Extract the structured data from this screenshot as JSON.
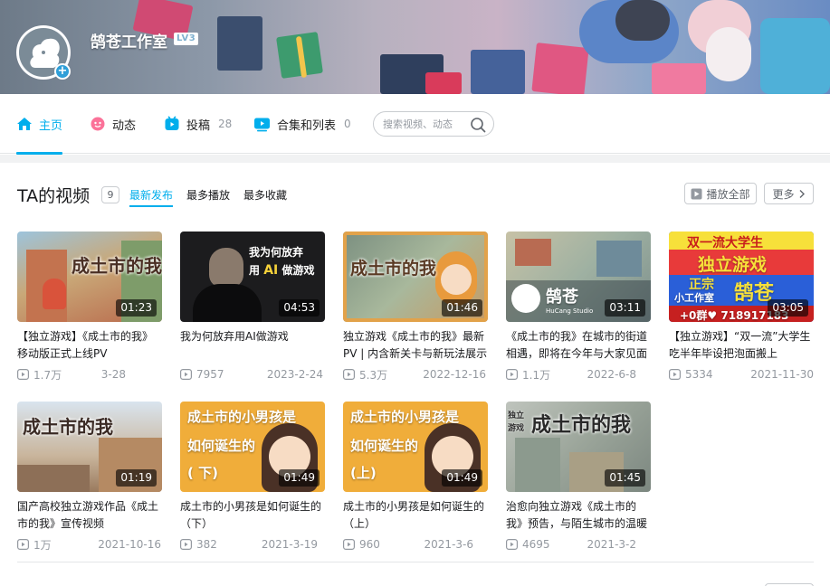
{
  "profile": {
    "name": "鹄苍工作室",
    "level": "LV3"
  },
  "nav": {
    "home": "主页",
    "dynamic": "动态",
    "videos": "投稿",
    "videos_count": "28",
    "collections": "合集和列表",
    "collections_count": "0"
  },
  "search": {
    "placeholder": "搜索视频、动态"
  },
  "section": {
    "title": "TA的视频",
    "count": "9",
    "sort_tabs": [
      "最新发布",
      "最多播放",
      "最多收藏"
    ],
    "play_all": "播放全部",
    "more": "更多"
  },
  "videos": [
    {
      "title": "【独立游戏】《成土市的我》移动版正式上线PV",
      "plays": "1.7万",
      "date": "3-28",
      "duration": "01:23",
      "thumb_text": "成土市的我"
    },
    {
      "title": "我为何放弃用AI做游戏",
      "plays": "7957",
      "date": "2023-2-24",
      "duration": "04:53",
      "thumb_text": "我为何放弃",
      "thumb_text2": "用",
      "thumb_text3": "AI",
      "thumb_text4": "做游戏"
    },
    {
      "title": "独立游戏《成土市的我》最新PV | 内含新关卡与新玩法展示",
      "plays": "5.3万",
      "date": "2022-12-16",
      "duration": "01:46",
      "thumb_text": "成土市的我"
    },
    {
      "title": "《成土市的我》在城市的街道相遇，即将在今年与大家见面",
      "plays": "1.1万",
      "date": "2022-6-8",
      "duration": "03:11",
      "thumb_text": "鹄苍",
      "thumb_text2": "HuCang Studio"
    },
    {
      "title": "【独立游戏】“双一流”大学生吃半年毕设把泡面搬上",
      "plays": "5334",
      "date": "2021-11-30",
      "duration": "03:05",
      "thumb_text": "双一流大学生",
      "thumb_text2": "独立游戏",
      "thumb_text3": "正宗",
      "thumb_text4": "小工作室",
      "thumb_text5": "鹄苍",
      "thumb_text6": "+0群♥ 718917183"
    },
    {
      "title": "国产高校独立游戏作品《成土市的我》宣传视频",
      "plays": "1万",
      "date": "2021-10-16",
      "duration": "01:19",
      "thumb_text": "成土市的我"
    },
    {
      "title": "成土市的小男孩是如何诞生的（下）",
      "plays": "382",
      "date": "2021-3-19",
      "duration": "01:49",
      "thumb_text": "成土市的小男孩是",
      "thumb_text2": "如何诞生的",
      "thumb_text3": "( 下)"
    },
    {
      "title": "成土市的小男孩是如何诞生的（上）",
      "plays": "960",
      "date": "2021-3-6",
      "duration": "01:49",
      "thumb_text": "成土市的小男孩是",
      "thumb_text2": "如何诞生的",
      "thumb_text3": "(上)"
    },
    {
      "title": "治愈向独立游戏《成土市的我》预告，与陌生城市的温暖",
      "plays": "4695",
      "date": "2021-3-2",
      "duration": "01:45",
      "thumb_text": "成土市的我",
      "thumb_text2": "独立",
      "thumb_text3": "游戏"
    }
  ],
  "colors": {
    "accent": "#00aeec",
    "text": "#18191c",
    "muted": "#9499a0"
  }
}
